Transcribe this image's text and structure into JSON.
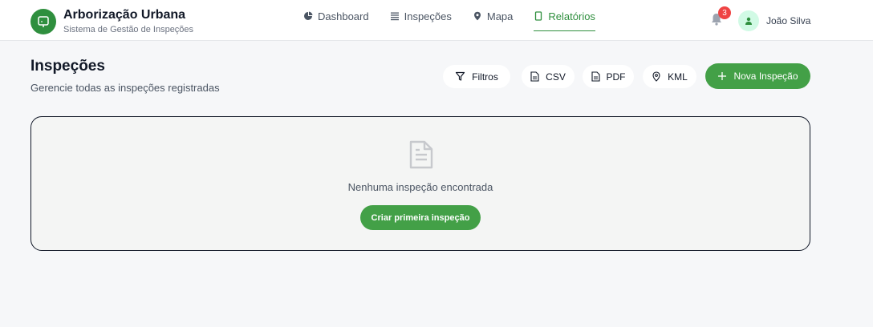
{
  "brand": {
    "title": "Arborização Urbana",
    "subtitle": "Sistema de Gestão de Inspeções",
    "logo_icon": "tree-icon"
  },
  "nav": {
    "items": [
      {
        "label": "Dashboard",
        "icon": "pie-chart-icon",
        "active": false
      },
      {
        "label": "Inspeções",
        "icon": "list-icon",
        "active": false
      },
      {
        "label": "Mapa",
        "icon": "map-pin-icon",
        "active": false
      },
      {
        "label": "Relatórios",
        "icon": "report-icon",
        "active": true
      }
    ]
  },
  "notifications": {
    "count": "3",
    "icon": "bell-icon"
  },
  "user": {
    "name": "João Silva",
    "icon": "user-icon"
  },
  "page": {
    "title": "Inspeções",
    "subtitle": "Gerencie todas as inspeções registradas"
  },
  "toolbar": {
    "filters_label": "Filtros",
    "csv_label": "CSV",
    "pdf_label": "PDF",
    "kml_label": "KML",
    "new_label": "Nova Inspeção"
  },
  "empty_state": {
    "message": "Nenhuma inspeção encontrada",
    "button_label": "Criar primeira inspeção",
    "icon": "document-icon"
  },
  "colors": {
    "accent": "#43a047",
    "brand": "#2f8f3e",
    "badge": "#ef4444"
  }
}
